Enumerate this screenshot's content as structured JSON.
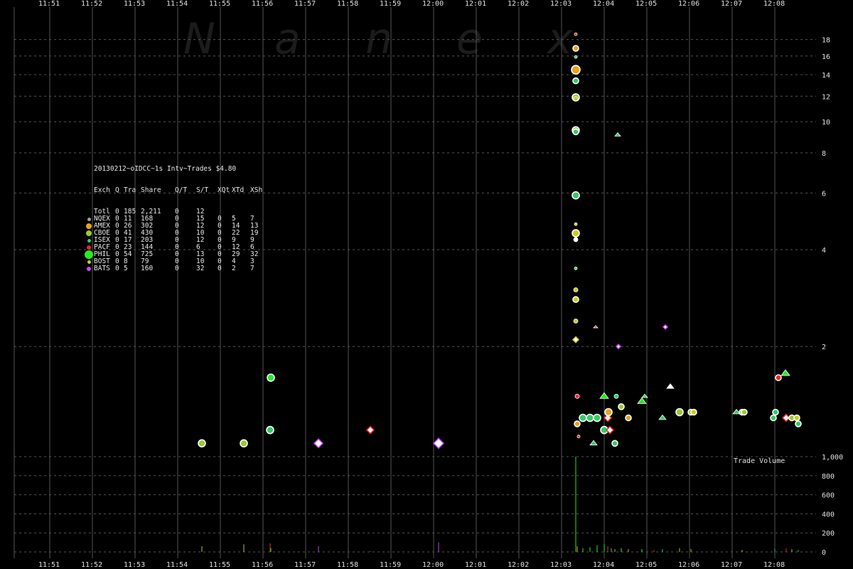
{
  "watermark": [
    "N",
    "a",
    "n",
    "e",
    "x"
  ],
  "stats": {
    "title": "20130212~oIDCC~1s Intv~Trades $4.80",
    "header": [
      "Exch",
      "Q",
      "Tra",
      "Share",
      "Q/T",
      "S/T",
      "XQt",
      "XTd",
      "XSh"
    ],
    "rows": [
      {
        "cells": [
          "Totl",
          "0",
          "185",
          "2,211",
          "0",
          "12",
          "",
          "",
          ""
        ],
        "color": "",
        "size": 0
      },
      {
        "cells": [
          "NQEX",
          "0",
          "11",
          "168",
          "0",
          "15",
          "0",
          "5",
          "7"
        ],
        "color": "#a0a0a0",
        "size": 5
      },
      {
        "cells": [
          "AMEX",
          "0",
          "26",
          "302",
          "0",
          "12",
          "0",
          "14",
          "13"
        ],
        "color": "#f0a020",
        "size": 8
      },
      {
        "cells": [
          "CBOE",
          "0",
          "41",
          "430",
          "0",
          "10",
          "0",
          "22",
          "19"
        ],
        "color": "#99cc33",
        "size": 8
      },
      {
        "cells": [
          "ISEX",
          "0",
          "17",
          "203",
          "0",
          "12",
          "0",
          "9",
          "9"
        ],
        "color": "#33cc66",
        "size": 5
      },
      {
        "cells": [
          "PACF",
          "0",
          "23",
          "144",
          "0",
          "6",
          "0",
          "12",
          "6"
        ],
        "color": "#ff2222",
        "size": 6
      },
      {
        "cells": [
          "PHIL",
          "0",
          "54",
          "725",
          "0",
          "13",
          "0",
          "29",
          "32"
        ],
        "color": "#22ee22",
        "size": 12
      },
      {
        "cells": [
          "BOST",
          "0",
          "8",
          "79",
          "0",
          "10",
          "0",
          "4",
          "3"
        ],
        "color": "#cccc22",
        "size": 5
      },
      {
        "cells": [
          "BATS",
          "0",
          "5",
          "160",
          "0",
          "32",
          "0",
          "2",
          "7"
        ],
        "color": "#cc44ff",
        "size": 6
      }
    ]
  },
  "chart_data": {
    "type": "scatter",
    "title": "20130212~oIDCC~1s Intv~Trades $4.80",
    "x_ticks": [
      "11:51",
      "11:52",
      "11:53",
      "11:54",
      "11:55",
      "11:56",
      "11:57",
      "11:58",
      "11:59",
      "12:00",
      "12:01",
      "12:02",
      "12:03",
      "12:04",
      "12:05",
      "12:06",
      "12:07",
      "12:08"
    ],
    "x_range": [
      "11:50:10",
      "12:09:40"
    ],
    "price_axis": {
      "ticks": [
        2,
        4,
        6,
        8,
        10,
        12,
        14,
        16,
        18
      ],
      "range": [
        0.9,
        19
      ]
    },
    "volume_axis": {
      "label": "Trade Volume",
      "ticks": [
        "0",
        "200",
        "400",
        "600",
        "800",
        "1,000"
      ],
      "range": [
        0,
        1000
      ]
    },
    "grid": true,
    "colors": {
      "grid": "#555555",
      "background": "#000000"
    },
    "trades": [
      {
        "t": "11:54:34",
        "price": 1.0,
        "color": "#99cc33",
        "shape": "circle",
        "size": 5
      },
      {
        "t": "11:55:33",
        "price": 1.0,
        "color": "#99cc33",
        "shape": "circle",
        "size": 5
      },
      {
        "t": "11:56:10",
        "price": 1.1,
        "color": "#33cc66",
        "shape": "circle",
        "size": 5
      },
      {
        "t": "11:56:11",
        "price": 1.6,
        "color": "#22ee22",
        "shape": "circle",
        "size": 5
      },
      {
        "t": "11:57:18",
        "price": 1.0,
        "color": "#cc44ff",
        "shape": "diamond",
        "size": 5
      },
      {
        "t": "11:58:31",
        "price": 1.1,
        "color": "#ff2222",
        "shape": "diamond",
        "size": 4
      },
      {
        "t": "12:00:07",
        "price": 1.0,
        "color": "#cc44ff",
        "shape": "diamond",
        "size": 6
      },
      {
        "t": "12:03:20",
        "price": 18.7,
        "color": "#ff2222",
        "shape": "circle",
        "size": 2
      },
      {
        "t": "12:03:20",
        "price": 16.9,
        "color": "#f0a020",
        "shape": "circle",
        "size": 4
      },
      {
        "t": "12:03:20",
        "price": 15.9,
        "color": "#33cc66",
        "shape": "circle",
        "size": 2
      },
      {
        "t": "12:03:20",
        "price": 14.5,
        "color": "#f0a020",
        "shape": "circle",
        "size": 6
      },
      {
        "t": "12:03:20",
        "price": 13.4,
        "color": "#33cc66",
        "shape": "circle",
        "size": 4
      },
      {
        "t": "12:03:20",
        "price": 11.9,
        "color": "#99cc33",
        "shape": "circle",
        "size": 5
      },
      {
        "t": "12:03:20",
        "price": 11.8,
        "color": "#cccc22",
        "shape": "circle",
        "size": 3
      },
      {
        "t": "12:03:20",
        "price": 9.4,
        "color": "#99cc33",
        "shape": "circle",
        "size": 5
      },
      {
        "t": "12:03:20",
        "price": 9.3,
        "color": "#33cc66",
        "shape": "circle",
        "size": 4
      },
      {
        "t": "12:03:20",
        "price": 5.9,
        "color": "#33cc66",
        "shape": "circle",
        "size": 5
      },
      {
        "t": "12:03:20",
        "price": 4.8,
        "color": "#cccc22",
        "shape": "circle",
        "size": 2
      },
      {
        "t": "12:03:20",
        "price": 4.5,
        "color": "#cccc22",
        "shape": "circle",
        "size": 5
      },
      {
        "t": "12:03:20",
        "price": 4.3,
        "color": "#ffffff",
        "shape": "circle",
        "size": 3
      },
      {
        "t": "12:03:20",
        "price": 3.5,
        "color": "#22ee22",
        "shape": "circle",
        "size": 2
      },
      {
        "t": "12:03:20",
        "price": 3.0,
        "color": "#cccc22",
        "shape": "circle",
        "size": 3
      },
      {
        "t": "12:03:20",
        "price": 2.8,
        "color": "#cccc22",
        "shape": "circle",
        "size": 4
      },
      {
        "t": "12:03:20",
        "price": 2.4,
        "color": "#cccc22",
        "shape": "circle",
        "size": 3
      },
      {
        "t": "12:03:20",
        "price": 2.1,
        "color": "#cccc22",
        "shape": "diamond",
        "size": 3
      },
      {
        "t": "12:03:22",
        "price": 1.4,
        "color": "#ff2222",
        "shape": "circle",
        "size": 3
      },
      {
        "t": "12:03:22",
        "price": 1.15,
        "color": "#f0a020",
        "shape": "circle",
        "size": 4
      },
      {
        "t": "12:03:24",
        "price": 1.05,
        "color": "#ff2222",
        "shape": "circle",
        "size": 2
      },
      {
        "t": "12:03:30",
        "price": 1.2,
        "color": "#33cc66",
        "shape": "circle",
        "size": 5
      },
      {
        "t": "12:03:40",
        "price": 1.2,
        "color": "#33cc66",
        "shape": "circle",
        "size": 5
      },
      {
        "t": "12:03:45",
        "price": 1.0,
        "color": "#33cc66",
        "shape": "triangle",
        "size": 4
      },
      {
        "t": "12:03:48",
        "price": 2.3,
        "color": "#ff2222",
        "shape": "triangle",
        "size": 2
      },
      {
        "t": "12:03:50",
        "price": 1.2,
        "color": "#33cc66",
        "shape": "circle",
        "size": 5
      },
      {
        "t": "12:04:00",
        "price": 1.1,
        "color": "#33cc66",
        "shape": "circle",
        "size": 5
      },
      {
        "t": "12:04:00",
        "price": 1.4,
        "color": "#22ee22",
        "shape": "triangle",
        "size": 5
      },
      {
        "t": "12:04:05",
        "price": 1.2,
        "color": "#ff2222",
        "shape": "diamond",
        "size": 4
      },
      {
        "t": "12:04:06",
        "price": 1.25,
        "color": "#f0a020",
        "shape": "circle",
        "size": 5
      },
      {
        "t": "12:04:08",
        "price": 1.1,
        "color": "#ff2222",
        "shape": "diamond",
        "size": 4
      },
      {
        "t": "12:04:15",
        "price": 1.0,
        "color": "#33cc66",
        "shape": "circle",
        "size": 4
      },
      {
        "t": "12:04:17",
        "price": 1.4,
        "color": "#33cc66",
        "shape": "circle",
        "size": 3
      },
      {
        "t": "12:04:19",
        "price": 9.1,
        "color": "#33cc66",
        "shape": "triangle",
        "size": 3
      },
      {
        "t": "12:04:20",
        "price": 2.0,
        "color": "#cc44ff",
        "shape": "diamond",
        "size": 2
      },
      {
        "t": "12:04:24",
        "price": 1.3,
        "color": "#99cc33",
        "shape": "circle",
        "size": 4
      },
      {
        "t": "12:04:34",
        "price": 1.2,
        "color": "#f0a020",
        "shape": "circle",
        "size": 4
      },
      {
        "t": "12:04:53",
        "price": 1.35,
        "color": "#22ee22",
        "shape": "triangle",
        "size": 5
      },
      {
        "t": "12:04:57",
        "price": 1.4,
        "color": "#22ee22",
        "shape": "triangle",
        "size": 3
      },
      {
        "t": "12:05:22",
        "price": 1.2,
        "color": "#33cc66",
        "shape": "triangle",
        "size": 4
      },
      {
        "t": "12:05:26",
        "price": 2.3,
        "color": "#cc44ff",
        "shape": "diamond",
        "size": 2
      },
      {
        "t": "12:05:33",
        "price": 1.5,
        "color": "#ffffff",
        "shape": "triangle",
        "size": 4
      },
      {
        "t": "12:05:46",
        "price": 1.25,
        "color": "#99cc33",
        "shape": "circle",
        "size": 5
      },
      {
        "t": "12:06:02",
        "price": 1.25,
        "color": "#99cc33",
        "shape": "circle",
        "size": 4
      },
      {
        "t": "12:06:06",
        "price": 1.25,
        "color": "#cccc22",
        "shape": "circle",
        "size": 4
      },
      {
        "t": "12:07:06",
        "price": 1.25,
        "color": "#33cc66",
        "shape": "triangle",
        "size": 4
      },
      {
        "t": "12:07:14",
        "price": 1.25,
        "color": "#cccc22",
        "shape": "circle",
        "size": 4
      },
      {
        "t": "12:07:17",
        "price": 1.25,
        "color": "#99cc33",
        "shape": "circle",
        "size": 4
      },
      {
        "t": "12:07:58",
        "price": 1.2,
        "color": "#33cc66",
        "shape": "circle",
        "size": 4
      },
      {
        "t": "12:08:01",
        "price": 1.25,
        "color": "#33cc66",
        "shape": "circle",
        "size": 4
      },
      {
        "t": "12:08:05",
        "price": 1.6,
        "color": "#ff2222",
        "shape": "circle",
        "size": 4
      },
      {
        "t": "12:08:15",
        "price": 1.65,
        "color": "#22ee22",
        "shape": "triangle",
        "size": 5
      },
      {
        "t": "12:08:16",
        "price": 1.2,
        "color": "#ff2222",
        "shape": "diamond",
        "size": 4
      },
      {
        "t": "12:08:24",
        "price": 1.2,
        "color": "#99cc33",
        "shape": "circle",
        "size": 4
      },
      {
        "t": "12:08:31",
        "price": 1.2,
        "color": "#cccc22",
        "shape": "circle",
        "size": 4
      },
      {
        "t": "12:08:33",
        "price": 1.15,
        "color": "#33cc66",
        "shape": "circle",
        "size": 4
      }
    ],
    "volumes": [
      {
        "t": "11:54:34",
        "v": 60,
        "color": "#99cc33"
      },
      {
        "t": "11:55:33",
        "v": 80,
        "color": "#99cc33"
      },
      {
        "t": "11:56:10",
        "v": 90,
        "color": "#ff2222"
      },
      {
        "t": "11:56:11",
        "v": 40,
        "color": "#22ee22"
      },
      {
        "t": "11:57:18",
        "v": 60,
        "color": "#cc44ff"
      },
      {
        "t": "11:58:31",
        "v": 10,
        "color": "#ff2222"
      },
      {
        "t": "12:00:07",
        "v": 100,
        "color": "#cc44ff"
      },
      {
        "t": "12:03:20",
        "v": 1000,
        "color": "#22ee22"
      },
      {
        "t": "12:03:22",
        "v": 60,
        "color": "#f0a020"
      },
      {
        "t": "12:03:30",
        "v": 40,
        "color": "#22ee22"
      },
      {
        "t": "12:03:40",
        "v": 50,
        "color": "#22ee22"
      },
      {
        "t": "12:03:50",
        "v": 70,
        "color": "#22ee22"
      },
      {
        "t": "12:04:00",
        "v": 80,
        "color": "#22ee22"
      },
      {
        "t": "12:04:05",
        "v": 60,
        "color": "#ff2222"
      },
      {
        "t": "12:04:10",
        "v": 40,
        "color": "#33cc66"
      },
      {
        "t": "12:04:15",
        "v": 30,
        "color": "#99cc33"
      },
      {
        "t": "12:04:24",
        "v": 40,
        "color": "#99cc33"
      },
      {
        "t": "12:04:34",
        "v": 30,
        "color": "#f0a020"
      },
      {
        "t": "12:04:53",
        "v": 30,
        "color": "#22ee22"
      },
      {
        "t": "12:05:10",
        "v": 20,
        "color": "#ff2222"
      },
      {
        "t": "12:05:22",
        "v": 30,
        "color": "#33cc66"
      },
      {
        "t": "12:05:46",
        "v": 40,
        "color": "#99cc33"
      },
      {
        "t": "12:06:02",
        "v": 30,
        "color": "#99cc33"
      },
      {
        "t": "12:07:14",
        "v": 20,
        "color": "#cccc22"
      },
      {
        "t": "12:08:00",
        "v": 30,
        "color": "#33cc66"
      },
      {
        "t": "12:08:16",
        "v": 40,
        "color": "#ff2222"
      },
      {
        "t": "12:08:24",
        "v": 30,
        "color": "#99cc33"
      },
      {
        "t": "12:08:33",
        "v": 20,
        "color": "#33cc66"
      }
    ]
  }
}
